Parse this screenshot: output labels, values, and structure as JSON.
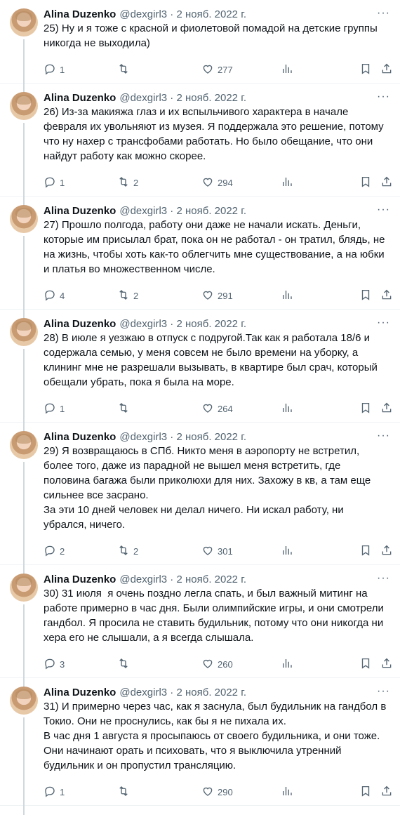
{
  "author": {
    "name": "Alina Duzenko",
    "handle": "@dexgirl3",
    "date": "2 нояб. 2022 г."
  },
  "tweets": [
    {
      "text": "25) Ну и я тоже с красной и фиолетовой помадой на детские группы никогда не выходила)",
      "replies": "1",
      "retweets": "",
      "likes": "277"
    },
    {
      "text": "26) Из-за макияжа глаз и их вспыльчивого характера в начале февраля их увольняют из музея. Я поддержала это решение, потому что ну нахер с трансфобами работать. Но было обещание, что они найдут работу как можно скорее.",
      "replies": "1",
      "retweets": "2",
      "likes": "294"
    },
    {
      "text": "27) Прошло полгода, работу они даже не начали искать. Деньги, которые им присылал брат, пока он не работал - он тратил, блядь, не на жизнь, чтобы хоть как-то облегчить мне существование, а на юбки и платья во множественном числе.",
      "replies": "4",
      "retweets": "2",
      "likes": "291"
    },
    {
      "text": "28) В июле я уезжаю в отпуск с подругой.Так как я работала 18/6 и содержала семью, у меня совсем не было времени на уборку, а клининг мне не разрешали вызывать, в квартире был срач, который обещали убрать, пока я была на море.",
      "replies": "1",
      "retweets": "",
      "likes": "264"
    },
    {
      "text": "29) Я возвращаюсь в СПб. Никто меня в аэропорту не встретил, более того, даже из парадной не вышел меня встретить, где половина багажа были приколюхи для них. Захожу в кв, а там еще сильнее все засрано.\nЗа эти 10 дней человек ни делал ничего. Ни искал работу, ни убрался, ничего.",
      "replies": "2",
      "retweets": "2",
      "likes": "301"
    },
    {
      "text": "30) 31 июля  я очень поздно легла спать, и был важный митинг на работе примерно в час дня. Были олимпийские игры, и они смотрели гандбол. Я просила не ставить будильник, потому что они никогда ни хера его не слышали, а я всегда слышала.",
      "replies": "3",
      "retweets": "",
      "likes": "260"
    },
    {
      "text": "31) И примерно через час, как я заснула, был будильник на гандбол в Токио. Они не проснулись, как бы я не пихала их.\nВ час дня 1 августа я просыпаюсь от своего будильника, и они тоже.\nОни начинают орать и психовать, что я выключила утренний будильник и он пропустил трансляцию.",
      "replies": "1",
      "retweets": "",
      "likes": "290"
    }
  ],
  "icons": {
    "reply": "reply-icon",
    "retweet": "retweet-icon",
    "like": "heart-icon",
    "views": "views-icon",
    "bookmark": "bookmark-icon",
    "share": "share-icon",
    "more": "more-icon"
  },
  "colors": {
    "text": "#0f1419",
    "secondary": "#536471",
    "thread_line": "#cfd9de"
  }
}
